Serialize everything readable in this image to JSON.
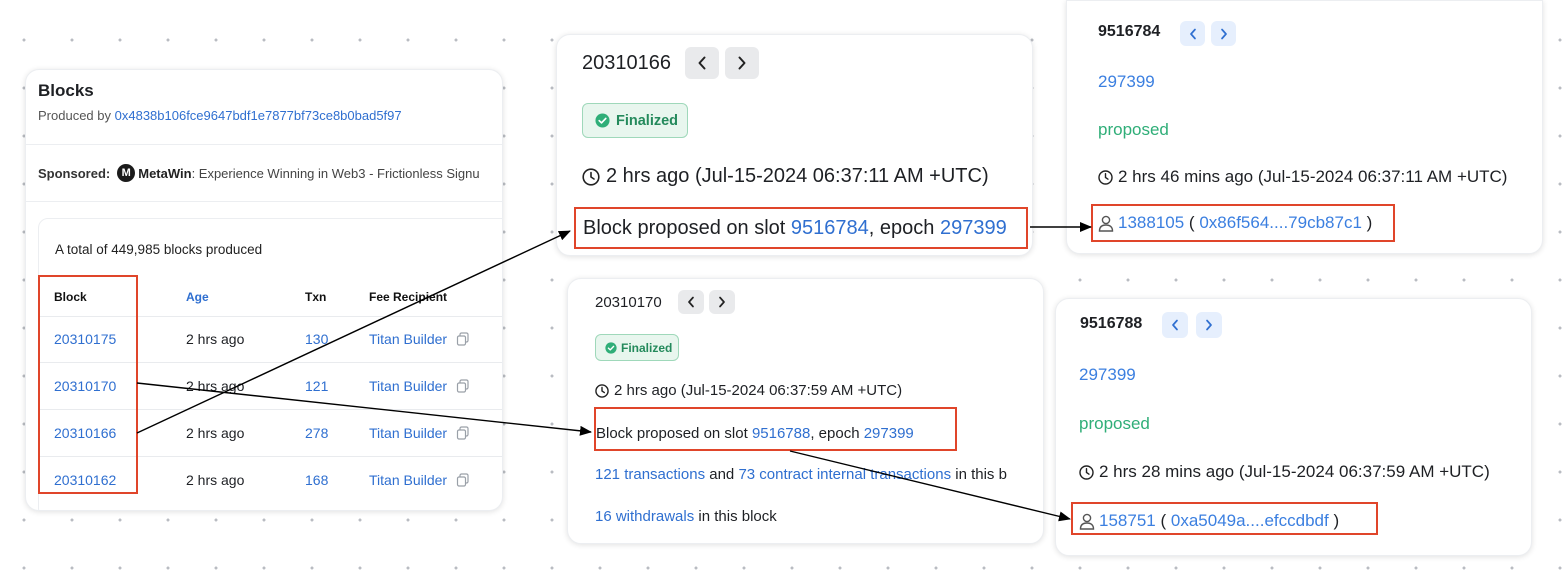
{
  "blocks_panel": {
    "title": "Blocks",
    "produced_by_label": "Produced by",
    "produced_by_address": "0x4838b106fce9647bdf1e7877bf73ce8b0bad5f97",
    "sponsored_label": "Sponsored:",
    "sponsor_name": "MetaWin",
    "sponsor_text": ": Experience Winning in Web3 - Frictionless Signu",
    "total_text": "A total of 449,985 blocks produced",
    "columns": [
      "Block",
      "Age",
      "Txn",
      "Fee Recipient"
    ],
    "rows": [
      {
        "block": "20310175",
        "age": "2 hrs ago",
        "txn": "130",
        "recipient": "Titan Builder"
      },
      {
        "block": "20310170",
        "age": "2 hrs ago",
        "txn": "121",
        "recipient": "Titan Builder"
      },
      {
        "block": "20310166",
        "age": "2 hrs ago",
        "txn": "278",
        "recipient": "Titan Builder"
      },
      {
        "block": "20310162",
        "age": "2 hrs ago",
        "txn": "168",
        "recipient": "Titan Builder"
      }
    ]
  },
  "block_top": {
    "number": "20310166",
    "status": "Finalized",
    "time": "2 hrs ago (Jul-15-2024 06:37:11 AM +UTC)",
    "proposed_prefix": "Block proposed on slot ",
    "slot": "9516784",
    "epoch_sep": ", epoch ",
    "epoch": "297399"
  },
  "block_bottom": {
    "number": "20310170",
    "status": "Finalized",
    "time": "2 hrs ago (Jul-15-2024 06:37:59 AM +UTC)",
    "proposed_prefix": "Block proposed on slot ",
    "slot": "9516788",
    "epoch_sep": ", epoch ",
    "epoch": "297399",
    "tx_count": "121 transactions",
    "and": " and ",
    "internal_tx": "73 contract internal transactions",
    "tx_suffix": " in this b",
    "withdrawals": "16 withdrawals",
    "withdrawals_suffix": " in this block"
  },
  "slot_top": {
    "slot": "9516784",
    "epoch": "297399",
    "status": "proposed",
    "time": "2 hrs 46 mins ago (Jul-15-2024 06:37:11 AM +UTC)",
    "proposer_index": "1388105",
    "paren_open": "(",
    "proposer_address": "0x86f564....79cb87c1",
    "paren_close": ")"
  },
  "slot_bottom": {
    "slot": "9516788",
    "epoch": "297399",
    "status": "proposed",
    "time": "2 hrs 28 mins ago (Jul-15-2024 06:37:59 AM +UTC)",
    "proposer_index": "158751",
    "paren_open": "(",
    "proposer_address": "0xa5049a....efccdbdf",
    "paren_close": ")"
  },
  "colors": {
    "link": "#2f6fd0",
    "finalized_green": "#2fae78",
    "highlight_red": "#e0452a",
    "arrow": "#000000"
  }
}
